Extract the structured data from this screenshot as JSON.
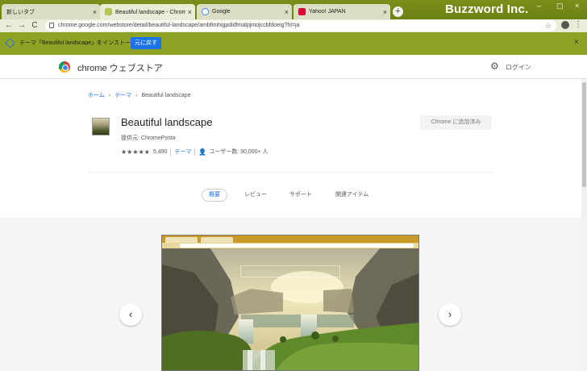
{
  "tabs": [
    {
      "title": "新しいタブ",
      "close": "×"
    },
    {
      "title": "Beautiful landscape - Chrome ウ",
      "close": "×"
    },
    {
      "title": "Google",
      "close": "×"
    },
    {
      "title": "Yahoo! JAPAN",
      "close": "×"
    }
  ],
  "new_tab": "+",
  "brand": "Buzzword Inc.",
  "window_controls": {
    "minimize": "–",
    "maximize": "▢",
    "close": "×"
  },
  "toolbar": {
    "back": "←",
    "forward": "→",
    "reload": "C",
    "url": "chrome.google.com/webstore/detail/beautiful-landscape/ambfimhigpdidfmalpjmojccbfdoeig?hl=ja",
    "star": "☆",
    "menu": "⋮"
  },
  "infobar": {
    "text": "テーマ「Beautiful landscape」をインストールしました",
    "undo": "元に戻す",
    "close": "×"
  },
  "store": {
    "title": "chrome ウェブストア",
    "gear": "⚙",
    "login": "ログイン"
  },
  "breadcrumb": {
    "home": "ホーム",
    "theme": "テーマ",
    "current": "Beautiful landscape",
    "sep": "›"
  },
  "extension": {
    "name": "Beautiful landscape",
    "provider": "提供元: ChromePosta",
    "stars": "★★★★★",
    "rating_count": "5,490",
    "category": "テーマ",
    "user_icon": "👤",
    "users": "ユーザー数: 90,000+ 人",
    "added": "Chrome に追加済み"
  },
  "page_tabs": [
    "概要",
    "レビュー",
    "サポート",
    "関連アイテム"
  ],
  "gallery": {
    "prev": "‹",
    "next": "›"
  },
  "colors": {
    "theme_bar": "#6d8214",
    "infobar": "#8ea223",
    "accent": "#1a73e8"
  }
}
